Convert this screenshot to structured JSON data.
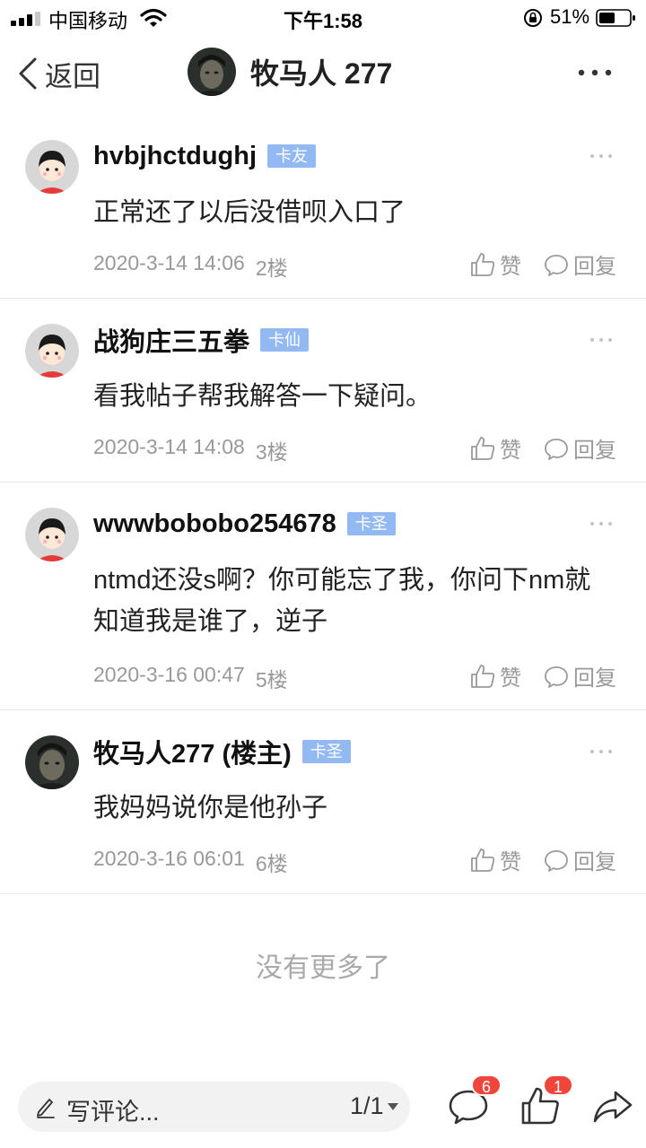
{
  "status_bar": {
    "carrier": "中国移动",
    "time": "下午1:58",
    "battery": "51%",
    "icons": [
      "signal-icon",
      "wifi-icon",
      "rotation-lock-icon",
      "battery-icon"
    ]
  },
  "nav": {
    "back_label": "返回",
    "title": "牧马人 277",
    "more_icon": "more-dots-icon"
  },
  "posts": [
    {
      "author": "hvbjhctdughj",
      "badge": "卡友",
      "content": "正常还了以后没借呗入口了",
      "date": "2020-3-14 14:06",
      "floor": "2楼",
      "like_label": "赞",
      "reply_label": "回复",
      "avatar": "cartoon-avatar"
    },
    {
      "author": "战狗庄三五拳",
      "badge": "卡仙",
      "content": "看我帖子帮我解答一下疑问。",
      "date": "2020-3-14 14:08",
      "floor": "3楼",
      "like_label": "赞",
      "reply_label": "回复",
      "avatar": "cartoon-avatar"
    },
    {
      "author": "wwwbobobo254678",
      "badge": "卡圣",
      "content": "ntmd还没s啊？你可能忘了我，你问下nm就知道我是谁了，逆子",
      "date": "2020-3-16 00:47",
      "floor": "5楼",
      "like_label": "赞",
      "reply_label": "回复",
      "avatar": "cartoon-avatar"
    },
    {
      "author": "牧马人277 (楼主)",
      "badge": "卡圣",
      "content": "我妈妈说你是他孙子",
      "date": "2020-3-16 06:01",
      "floor": "6楼",
      "like_label": "赞",
      "reply_label": "回复",
      "avatar": "photo-avatar"
    }
  ],
  "no_more": "没有更多了",
  "bottom_bar": {
    "comment_placeholder": "写评论...",
    "page": "1/1",
    "comments_count": "6",
    "likes_count": "1",
    "icons": [
      "pen-icon",
      "comment-icon",
      "like-icon",
      "share-icon"
    ]
  },
  "colors": {
    "badge": "#92b9f2",
    "count_badge": "#f0453a",
    "meta_text": "#999999",
    "divider": "#e8e8e8"
  }
}
